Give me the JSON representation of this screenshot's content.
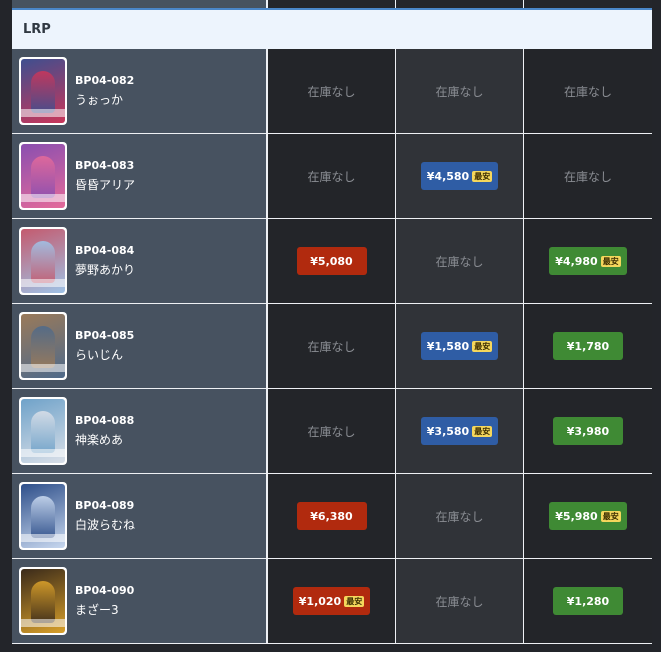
{
  "section": {
    "title": "LRP"
  },
  "labels": {
    "out_of_stock": "在庫なし",
    "cheapest": "最安"
  },
  "colors": {
    "red": "#b12a0e",
    "blue": "#2f5da5",
    "green": "#3f8a34",
    "badge": "#f5d75c",
    "header_border": "#4a87c9"
  },
  "rows": [
    {
      "code": "BP04-082",
      "name": "うぉっか",
      "cells": [
        {
          "kind": "oos",
          "text": "在庫なし"
        },
        {
          "kind": "oos",
          "text": "在庫なし"
        },
        {
          "kind": "oos",
          "text": "在庫なし"
        }
      ]
    },
    {
      "code": "BP04-083",
      "name": "昏昏アリア",
      "cells": [
        {
          "kind": "oos",
          "text": "在庫なし"
        },
        {
          "kind": "price",
          "color": "blue",
          "text": "¥4,580",
          "badge": "最安"
        },
        {
          "kind": "oos",
          "text": "在庫なし"
        }
      ]
    },
    {
      "code": "BP04-084",
      "name": "夢野あかり",
      "cells": [
        {
          "kind": "price",
          "color": "red",
          "text": "¥5,080"
        },
        {
          "kind": "oos",
          "text": "在庫なし"
        },
        {
          "kind": "price",
          "color": "green",
          "text": "¥4,980",
          "badge": "最安"
        }
      ]
    },
    {
      "code": "BP04-085",
      "name": "らいじん",
      "cells": [
        {
          "kind": "oos",
          "text": "在庫なし"
        },
        {
          "kind": "price",
          "color": "blue",
          "text": "¥1,580",
          "badge": "最安"
        },
        {
          "kind": "price",
          "color": "green",
          "text": "¥1,780"
        }
      ]
    },
    {
      "code": "BP04-088",
      "name": "神楽めあ",
      "cells": [
        {
          "kind": "oos",
          "text": "在庫なし"
        },
        {
          "kind": "price",
          "color": "blue",
          "text": "¥3,580",
          "badge": "最安"
        },
        {
          "kind": "price",
          "color": "green",
          "text": "¥3,980"
        }
      ]
    },
    {
      "code": "BP04-089",
      "name": "白波らむね",
      "cells": [
        {
          "kind": "price",
          "color": "red",
          "text": "¥6,380"
        },
        {
          "kind": "oos",
          "text": "在庫なし"
        },
        {
          "kind": "price",
          "color": "green",
          "text": "¥5,980",
          "badge": "最安"
        }
      ]
    },
    {
      "code": "BP04-090",
      "name": "まざー3",
      "cells": [
        {
          "kind": "price",
          "color": "red",
          "text": "¥1,020",
          "badge": "最安"
        },
        {
          "kind": "oos",
          "text": "在庫なし"
        },
        {
          "kind": "price",
          "color": "green",
          "text": "¥1,280"
        }
      ]
    }
  ]
}
